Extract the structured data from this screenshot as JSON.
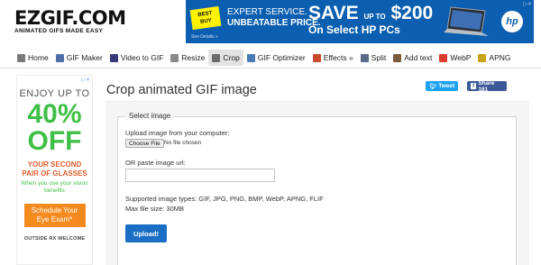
{
  "logo": {
    "main": "EZGIF.COM",
    "tagline": "ANIMATED GIFS MADE EASY"
  },
  "top_ad": {
    "brand": "BEST BUY",
    "line1": "EXPERT SERVICE.",
    "line2": "UNBEATABLE PRICE.",
    "details": "See Details »",
    "save_prefix": "SAVE",
    "save_up": "UP TO",
    "save_amount": "$200",
    "on_select": "On Select HP PCs",
    "hp_logo": "hp",
    "close_label": "▷✕"
  },
  "nav": {
    "items": [
      {
        "label": "Home",
        "icon": "home-icon",
        "color": "#7a7a7a"
      },
      {
        "label": "GIF Maker",
        "icon": "gif-maker-icon",
        "color": "#4f6ea8"
      },
      {
        "label": "Video to GIF",
        "icon": "video-icon",
        "color": "#3a3a7a"
      },
      {
        "label": "Resize",
        "icon": "resize-icon",
        "color": "#8a8a8a"
      },
      {
        "label": "Crop",
        "icon": "crop-icon",
        "color": "#6a6a6a"
      },
      {
        "label": "GIF Optimizer",
        "icon": "optimizer-icon",
        "color": "#4a7ab8"
      },
      {
        "label": "Effects »",
        "icon": "effects-icon",
        "color": "#c74a2b"
      },
      {
        "label": "Split",
        "icon": "split-icon",
        "color": "#5a6a8a"
      },
      {
        "label": "Add text",
        "icon": "add-text-icon",
        "color": "#7a5a3a"
      },
      {
        "label": "WebP",
        "icon": "webp-icon",
        "color": "#d93a2b"
      },
      {
        "label": "APNG",
        "icon": "apng-icon",
        "color": "#c4a51a"
      }
    ],
    "active_index": 4
  },
  "side_ad": {
    "close_label": "▷✕",
    "enjoy": "ENJOY UP TO",
    "percent": "40%",
    "off": "OFF",
    "your_second": "YOUR SECOND",
    "pair": "PAIR OF GLASSES",
    "when": "When you use your vision benefits",
    "schedule": "Schedule Your Eye Exam*",
    "outside": "OUTSIDE RX WELCOME"
  },
  "main": {
    "title": "Crop animated GIF image",
    "tweet_label": "Tweet",
    "share_label": "Share 181",
    "legend": "Select image",
    "upload_label": "Upload image from your computer:",
    "choose_file": "Choose File",
    "no_file": "No file chosen",
    "url_label": "OR paste image url:",
    "url_value": "",
    "supported": "Supported image types: GIF, JPG, PNG, BMP, WebP, APNG, FLIF",
    "max_size": "Max file size: 30MB",
    "upload_button": "Upload!"
  }
}
